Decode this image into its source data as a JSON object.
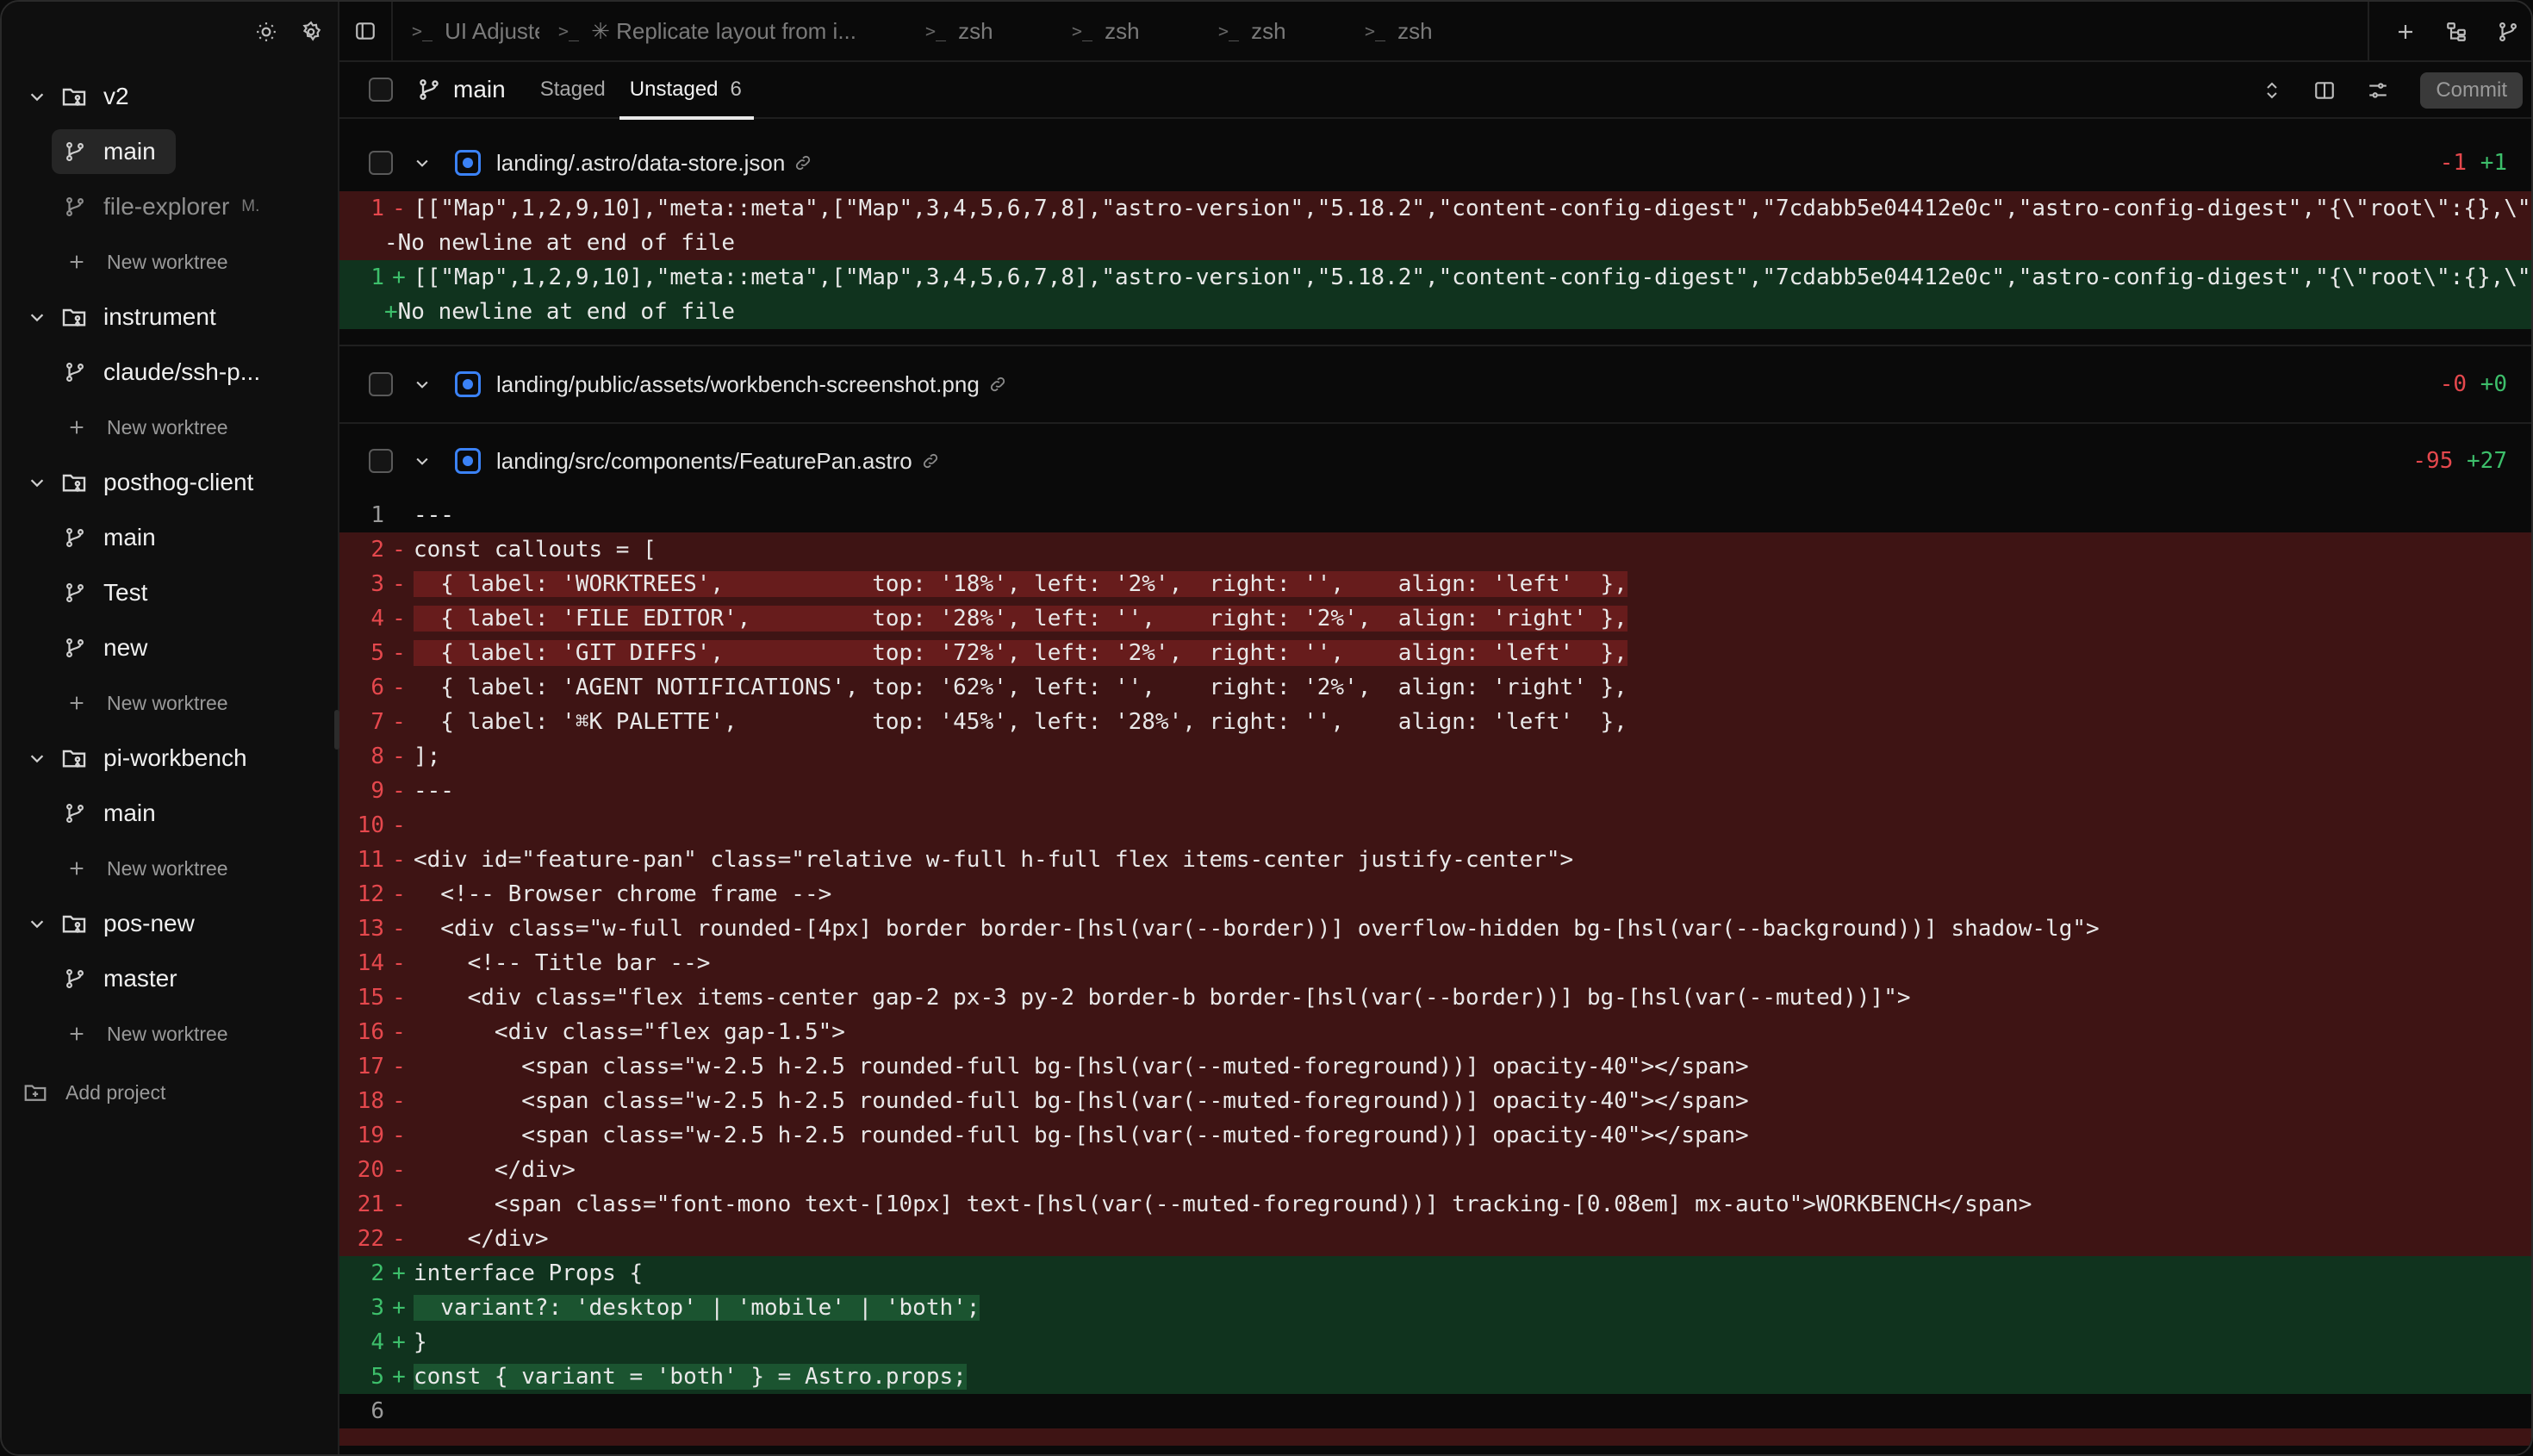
{
  "sidebar": {
    "projects": [
      {
        "name": "v2",
        "worktrees": [
          {
            "name": "main",
            "active": true
          },
          {
            "name": "file-explorer",
            "tag": "M.",
            "dim": true
          }
        ],
        "new_label": "New worktree"
      },
      {
        "name": "instrument",
        "worktrees": [
          {
            "name": "claude/ssh-p..."
          }
        ],
        "new_label": "New worktree"
      },
      {
        "name": "posthog-client",
        "worktrees": [
          {
            "name": "main"
          },
          {
            "name": "Test"
          },
          {
            "name": "new"
          }
        ],
        "new_label": "New worktree"
      },
      {
        "name": "pi-workbench",
        "worktrees": [
          {
            "name": "main"
          }
        ],
        "new_label": "New worktree"
      },
      {
        "name": "pos-new",
        "worktrees": [
          {
            "name": "master"
          }
        ],
        "new_label": "New worktree"
      }
    ],
    "add_project": "Add project"
  },
  "tabs": [
    {
      "label": "UI Adjuster"
    },
    {
      "label": "✳ Replicate layout from i..."
    },
    {
      "label": "zsh"
    },
    {
      "label": "zsh"
    },
    {
      "label": "zsh"
    },
    {
      "label": "zsh"
    }
  ],
  "subbar": {
    "branch": "main",
    "staged_label": "Staged",
    "unstaged_label": "Unstaged",
    "unstaged_count": "6",
    "commit_label": "Commit"
  },
  "files": [
    {
      "path": "landing/.astro/data-store.json",
      "del": "-1",
      "add": "+1",
      "lines": [
        "[[\"Map\",1,2,9,10],\"meta::meta\",[\"Map\",3,4,5,6,7,8],\"astro-version\",\"5.18.2\",\"content-config-digest\",\"7cdabb5e04412e0c\",\"astro-config-digest\",\"{\\\"root\\\":{},\\\"",
        "No newline at end of file"
      ]
    },
    {
      "path": "landing/public/assets/workbench-screenshot.png",
      "del": "-0",
      "add": "+0"
    },
    {
      "path": "landing/src/components/FeaturePan.astro",
      "del": "-95",
      "add": "+27",
      "lines": [
        "---",
        "const callouts = [",
        "  { label: 'WORKTREES',           top: '18%', left: '2%',  right: '',    align: 'left'  },",
        "  { label: 'FILE EDITOR',         top: '28%', left: '',    right: '2%',  align: 'right' },",
        "  { label: 'GIT DIFFS',           top: '72%', left: '2%',  right: '',    align: 'left'  },",
        "  { label: 'AGENT NOTIFICATIONS', top: '62%', left: '',    right: '2%',  align: 'right' },",
        "  { label: '⌘K PALETTE',          top: '45%', left: '28%', right: '',    align: 'left'  },",
        "];",
        "---",
        "",
        "<div id=\"feature-pan\" class=\"relative w-full h-full flex items-center justify-center\">",
        "  <!-- Browser chrome frame -->",
        "  <div class=\"w-full rounded-[4px] border border-[hsl(var(--border))] overflow-hidden bg-[hsl(var(--background))] shadow-lg\">",
        "    <!-- Title bar -->",
        "    <div class=\"flex items-center gap-2 px-3 py-2 border-b border-[hsl(var(--border))] bg-[hsl(var(--muted))]\">",
        "      <div class=\"flex gap-1.5\">",
        "        <span class=\"w-2.5 h-2.5 rounded-full bg-[hsl(var(--muted-foreground))] opacity-40\"></span>",
        "        <span class=\"w-2.5 h-2.5 rounded-full bg-[hsl(var(--muted-foreground))] opacity-40\"></span>",
        "        <span class=\"w-2.5 h-2.5 rounded-full bg-[hsl(var(--muted-foreground))] opacity-40\"></span>",
        "      </div>",
        "      <span class=\"font-mono text-[10px] text-[hsl(var(--muted-foreground))] tracking-[0.08em] mx-auto\">WORKBENCH</span>",
        "    </div>",
        "interface Props {",
        "  variant?: 'desktop' | 'mobile' | 'both';",
        "}",
        "const { variant = 'both' } = Astro.props;",
        ""
      ]
    }
  ]
}
